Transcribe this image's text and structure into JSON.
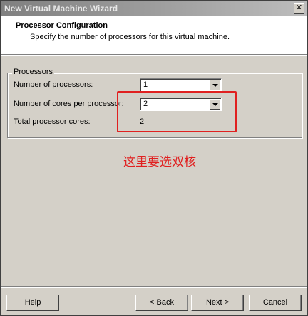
{
  "window": {
    "title": "New Virtual Machine Wizard",
    "close_glyph": "✕"
  },
  "header": {
    "title": "Processor Configuration",
    "subtitle": "Specify the number of processors for this virtual machine."
  },
  "processors_group": {
    "legend": "Processors",
    "num_processors": {
      "label": "Number of processors:",
      "value": "1"
    },
    "cores_per_processor": {
      "label": "Number of cores per processor:",
      "value": "2"
    },
    "total_cores": {
      "label": "Total processor cores:",
      "value": "2"
    }
  },
  "annotation": {
    "text": "这里要选双核",
    "color": "#e02020"
  },
  "buttons": {
    "help": "Help",
    "back": "< Back",
    "next": "Next >",
    "cancel": "Cancel"
  },
  "colors": {
    "dialog_bg": "#d4d0c8",
    "header_bg": "#ffffff",
    "highlight": "#e02020"
  }
}
